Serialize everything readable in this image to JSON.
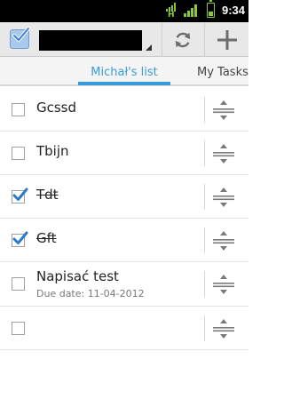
{
  "status_bar": {
    "time": "9:34",
    "network_label": "H",
    "icons": [
      "h-network-icon",
      "signal-strength-icon",
      "battery-icon"
    ]
  },
  "action_bar": {
    "icons": [
      "app-checklist-icon",
      "sync-icon",
      "add-icon"
    ],
    "colors": {
      "background": "#e8e8e8",
      "icon": "#6c6c6c"
    }
  },
  "tabs": [
    {
      "label": "Michał's list",
      "active": true
    },
    {
      "label": "My Tasks",
      "active": false
    }
  ],
  "tasks": [
    {
      "title": "Gcssd",
      "completed": false
    },
    {
      "title": "Tbijn",
      "completed": false
    },
    {
      "title": "Tdt",
      "completed": true
    },
    {
      "title": "Gft",
      "completed": true
    },
    {
      "title": "Napisać test",
      "completed": false,
      "due": "Due date: 11-04-2012"
    },
    {
      "title": "",
      "completed": false
    }
  ],
  "colors": {
    "accent": "#3a9bd9",
    "checkmark": "#2a7cc9",
    "status_green": "#8cc63f"
  }
}
